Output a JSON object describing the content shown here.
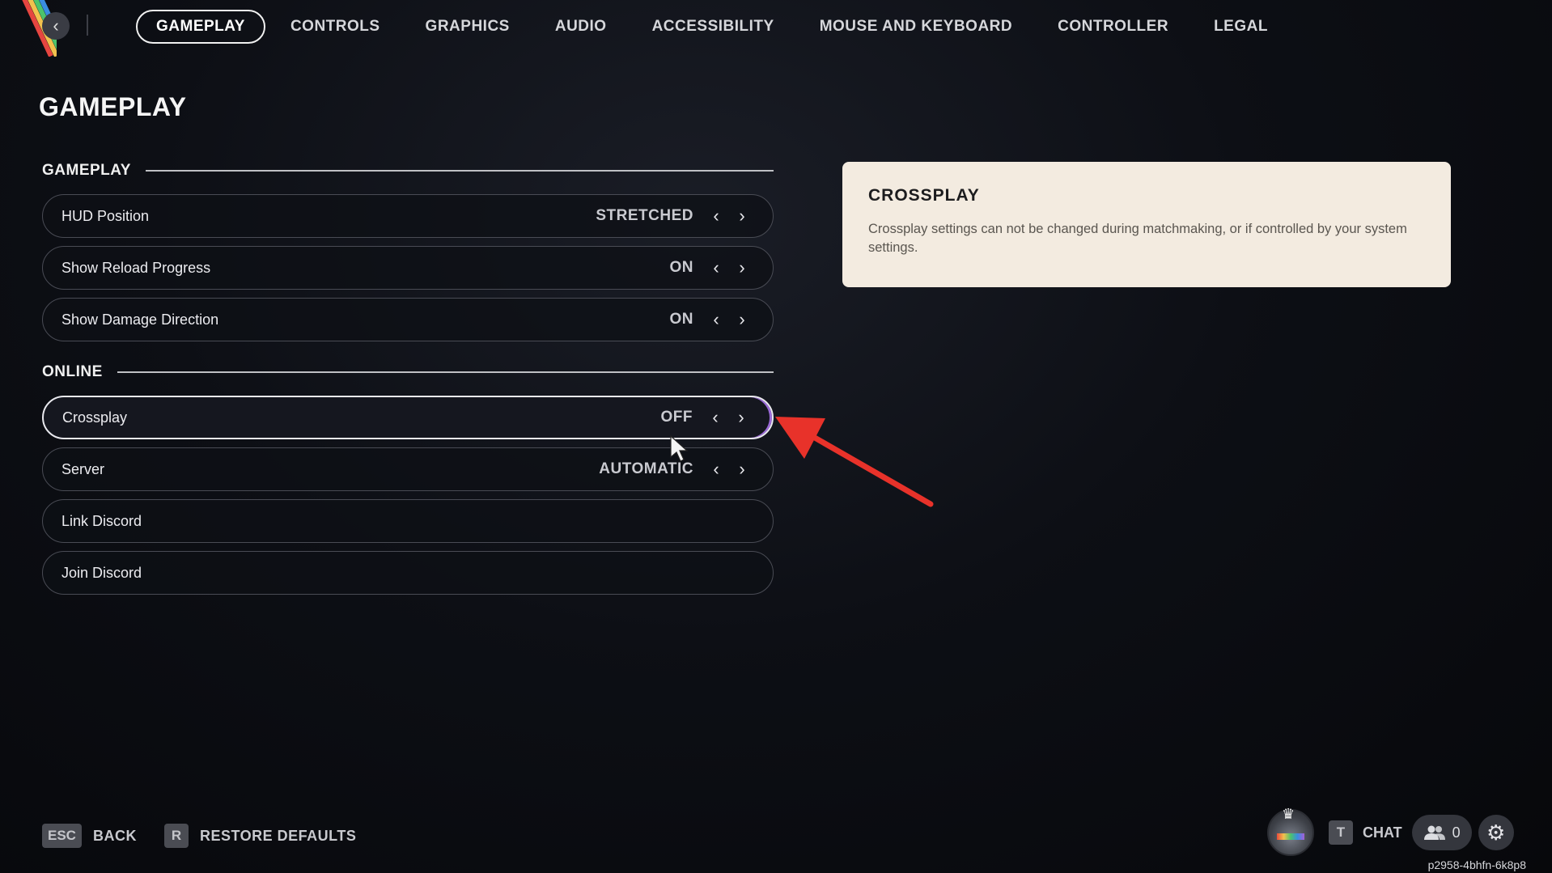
{
  "nav": {
    "back_icon": "chevron-left-icon",
    "tabs": [
      {
        "label": "GAMEPLAY",
        "active": true
      },
      {
        "label": "CONTROLS",
        "active": false
      },
      {
        "label": "GRAPHICS",
        "active": false
      },
      {
        "label": "AUDIO",
        "active": false
      },
      {
        "label": "ACCESSIBILITY",
        "active": false
      },
      {
        "label": "MOUSE AND KEYBOARD",
        "active": false
      },
      {
        "label": "CONTROLLER",
        "active": false
      },
      {
        "label": "LEGAL",
        "active": false
      }
    ]
  },
  "page": {
    "title": "GAMEPLAY"
  },
  "sections": {
    "gameplay": {
      "label": "GAMEPLAY",
      "rows": [
        {
          "label": "HUD Position",
          "value": "STRETCHED"
        },
        {
          "label": "Show Reload Progress",
          "value": "ON"
        },
        {
          "label": "Show Damage Direction",
          "value": "ON"
        }
      ]
    },
    "online": {
      "label": "ONLINE",
      "rows": [
        {
          "label": "Crossplay",
          "value": "OFF",
          "selected": true
        },
        {
          "label": "Server",
          "value": "AUTOMATIC"
        },
        {
          "label": "Link Discord"
        },
        {
          "label": "Join Discord"
        }
      ]
    }
  },
  "info_card": {
    "title": "CROSSPLAY",
    "text": "Crossplay settings can not be changed during matchmaking, or if controlled by your system settings."
  },
  "footer": {
    "back_key": "ESC",
    "back_label": "BACK",
    "restore_key": "R",
    "restore_label": "RESTORE DEFAULTS",
    "chat_key": "T",
    "chat_label": "CHAT",
    "friends_count": "0",
    "session_code": "p2958-4bhfn-6k8p8"
  },
  "colors": {
    "annotation_arrow": "#e8322a",
    "info_card_bg": "#f3ebe0",
    "selected_accent": "#9b6ad8"
  }
}
